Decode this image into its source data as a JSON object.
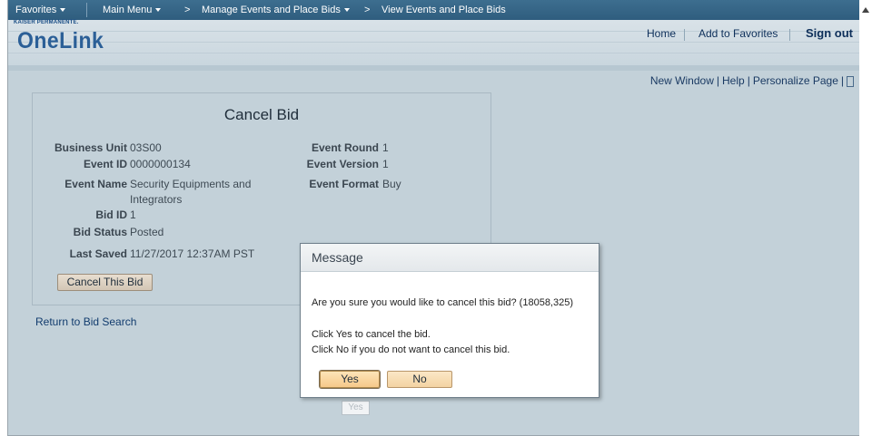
{
  "nav": {
    "favorites": "Favorites",
    "main_menu": "Main Menu",
    "crumb1": "Manage Events and Place Bids",
    "crumb2": "View Events and Place Bids",
    "chevron": ">"
  },
  "header": {
    "logo_small": "KAISER PERMANENTE.",
    "logo_big": "OneLink",
    "home": "Home",
    "add_favorites": "Add to Favorites",
    "sign_out": "Sign out"
  },
  "page_links": {
    "new_window": "New Window",
    "help": "Help",
    "personalize": "Personalize Page",
    "separator": "|"
  },
  "form": {
    "title": "Cancel Bid",
    "business_unit_label": "Business Unit",
    "business_unit": "03S00",
    "event_id_label": "Event ID",
    "event_id": "0000000134",
    "event_name_label": "Event Name",
    "event_name_line1": "Security Equipments and",
    "event_name_line2": "Integrators",
    "bid_id_label": "Bid ID",
    "bid_id": "1",
    "bid_status_label": "Bid Status",
    "bid_status": "Posted",
    "last_saved_label": "Last Saved",
    "last_saved": "11/27/2017 12:37AM PST",
    "event_round_label": "Event Round",
    "event_round": "1",
    "event_version_label": "Event Version",
    "event_version": "1",
    "event_format_label": "Event Format",
    "event_format": "Buy",
    "cancel_button": "Cancel This Bid",
    "return_link": "Return to Bid Search"
  },
  "dialog": {
    "title": "Message",
    "question": "Are you sure you would like to cancel this bid? (18058,325)",
    "line1": "Click Yes to cancel the bid.",
    "line2": "Click No if you do not want to cancel this bid.",
    "yes": "Yes",
    "no": "No"
  },
  "ghost_button": "Yes"
}
